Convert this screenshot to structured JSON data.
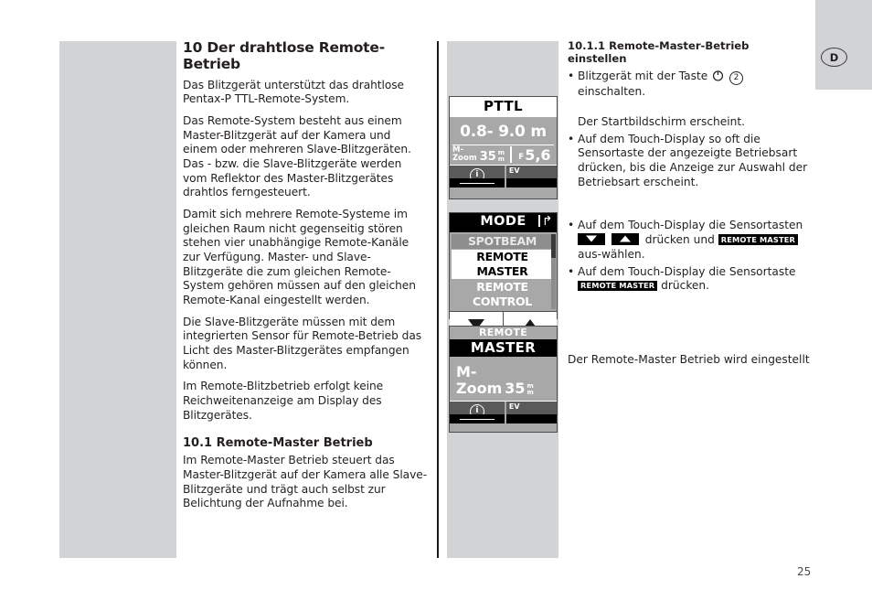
{
  "page": {
    "number": "25",
    "country_badge": "D"
  },
  "left_column": {
    "section_title": "10 Der drahtlose Remote-Betrieb",
    "paragraphs": [
      "Das Blitzgerät unterstützt das drahtlose Pentax-P TTL-Remote-System.",
      "Das Remote-System besteht aus einem Master-Blitzgerät auf der Kamera und einem oder mehreren Slave-Blitzgeräten. Das - bzw. die Slave-Blitzgeräte werden vom Reflektor des Master-Blitzgerätes drahtlos ferngesteuert.",
      "Damit sich mehrere Remote-Systeme im gleichen Raum nicht gegenseitig stören stehen vier unabhängige Remote-Kanäle zur Verfügung. Master- und Slave-Blitzgeräte die zum gleichen Remote-System gehören müssen auf den gleichen Remote-Kanal eingestellt werden.",
      "Die Slave-Blitzgeräte müssen mit dem integrierten Sensor für Remote-Betrieb das Licht des Master-Blitzgerätes empfangen können.",
      "Im Remote-Blitzbetrieb erfolgt keine Reichweitenanzeige am Display des Blitzgerätes."
    ],
    "subsection_title": "10.1 Remote-Master Betrieb",
    "subsection_text": "Im Remote-Master Betrieb steuert das Master-Blitzgerät auf der Kamera alle Slave-Blitzgeräte und trägt auch selbst zur Belichtung der Aufnahme bei."
  },
  "right_column": {
    "subsubsection_title": "10.1.1 Remote-Master-Betrieb einstellen",
    "bullet1_pre": "Blitzgerät mit der Taste",
    "bullet1_circled": "2",
    "bullet1_post": "einschalten.",
    "note1": "Der Startbildschirm erscheint.",
    "bullet2": "Auf dem Touch-Display so oft die Sensortaste der angezeigte Betriebsart drücken, bis die Anzeige zur Auswahl der Betriebsart erscheint.",
    "bullet3_pre": "Auf dem Touch-Display die Sensortasten",
    "bullet3_mid": "drücken und",
    "bullet3_badge": "REMOTE MASTER",
    "bullet3_post": "aus-wählen.",
    "bullet4_pre": "Auf dem Touch-Display die Sensortaste",
    "bullet4_badge": "REMOTE MASTER",
    "bullet4_post": "drücken.",
    "closing_text": "Der Remote-Master Betrieb wird eingestellt"
  },
  "lcd_pttl": {
    "title": "PTTL",
    "distance": "0.8- 9.0 m",
    "zoom_label_line1": "M-",
    "zoom_label_line2": "Zoom",
    "zoom_value": "35",
    "zoom_unit_line1": "m",
    "zoom_unit_line2": "m",
    "aperture_label": "F",
    "aperture_value": "5,6",
    "info_symbol": "i",
    "ev_label": "EV"
  },
  "lcd_mode": {
    "title": "MODE",
    "back_icon": "back-arrow-icon",
    "items": [
      {
        "label": "SPOTBEAM",
        "state": "dim"
      },
      {
        "label": "REMOTE MASTER",
        "state": "selected"
      },
      {
        "label": "REMOTE CONTROL",
        "state": "plain"
      }
    ],
    "button_down": "down-arrow-icon",
    "button_up": "up-arrow-icon"
  },
  "lcd_master": {
    "title_line1": "REMOTE",
    "title_line2": "MASTER",
    "zoom_label_line1": "M-",
    "zoom_label_line2": "Zoom",
    "zoom_value": "35",
    "zoom_unit_line1": "m",
    "zoom_unit_line2": "m",
    "info_symbol": "i",
    "ev_label": "EV"
  }
}
